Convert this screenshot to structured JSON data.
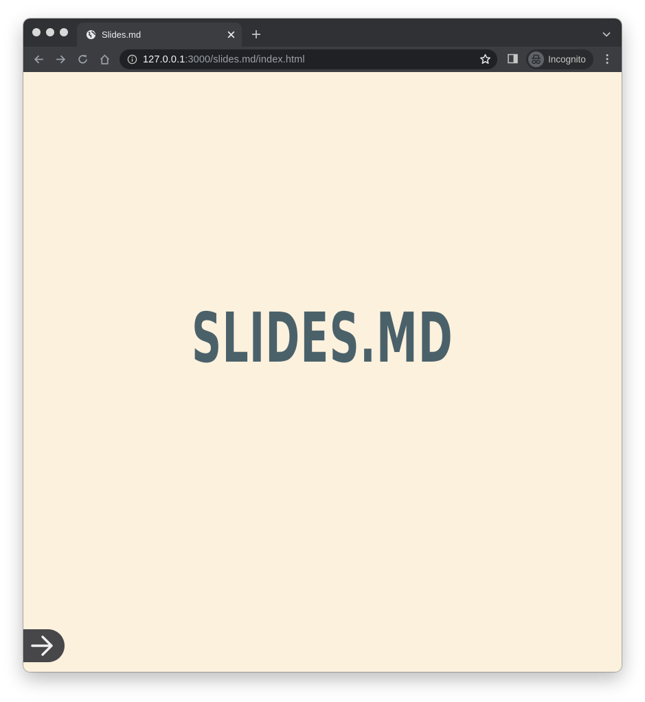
{
  "browser": {
    "tab": {
      "title": "Slides.md",
      "icon": "globe-icon"
    },
    "address": {
      "host": "127.0.0.1",
      "path": ":3000/slides.md/index.html"
    },
    "profile_label": "Incognito"
  },
  "slide": {
    "title": "SLIDES.MD",
    "background": "#fbf1dd",
    "title_color": "#4b616a"
  },
  "controls": {
    "next_icon": "arrow-right-icon"
  }
}
